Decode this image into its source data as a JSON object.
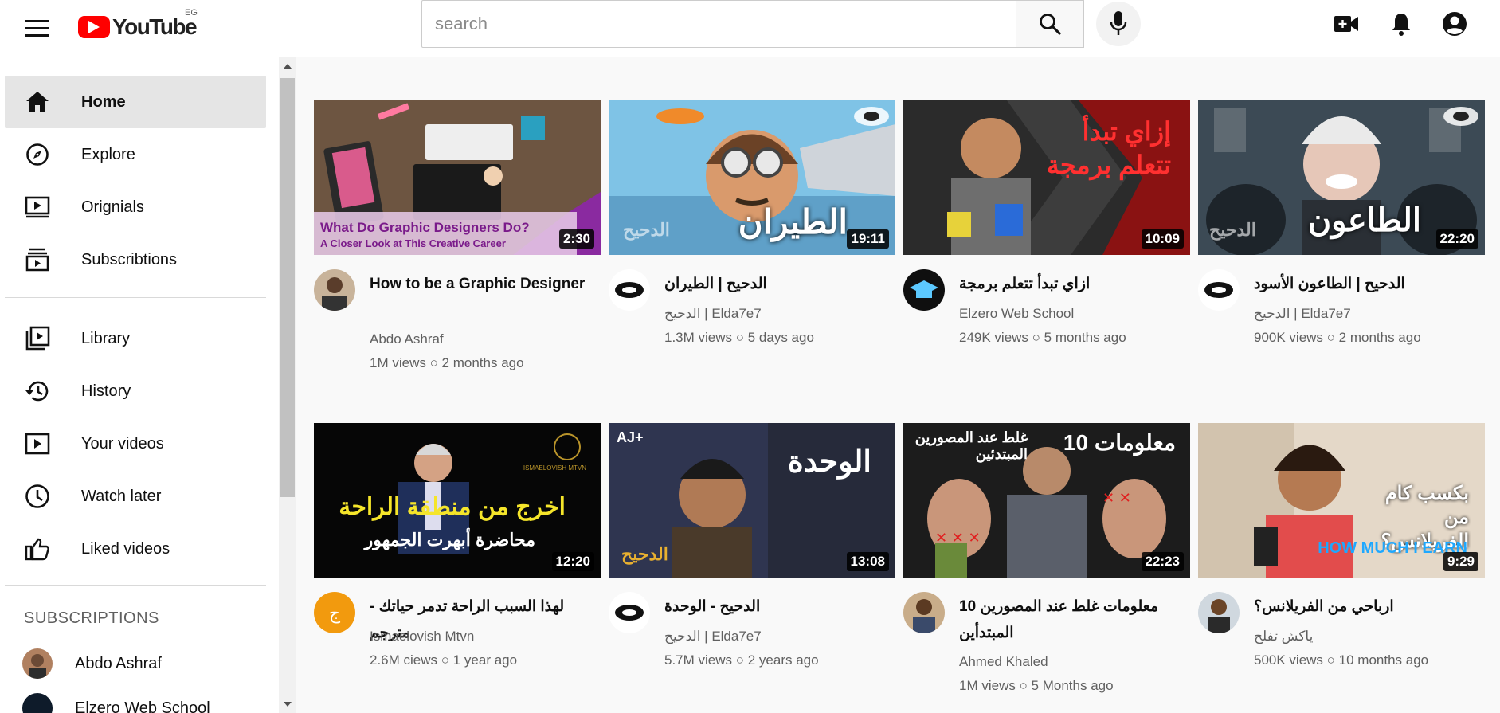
{
  "header": {
    "logo_text": "YouTube",
    "country_code": "EG",
    "search_placeholder": "search",
    "icons": [
      "hamburger-menu-icon",
      "search-icon",
      "microphone-icon",
      "video-camera-add-icon",
      "bell-icon",
      "account-circle-icon"
    ]
  },
  "sidebar": {
    "items": [
      {
        "label": "Home",
        "icon": "home-icon",
        "active": true
      },
      {
        "label": "Explore",
        "icon": "compass-icon"
      },
      {
        "label": "Orignials",
        "icon": "originals-icon"
      },
      {
        "label": "Subscribtions",
        "icon": "subscriptions-icon"
      },
      {
        "label": "Library",
        "icon": "library-icon"
      },
      {
        "label": "History",
        "icon": "history-icon"
      },
      {
        "label": "Your videos",
        "icon": "your-videos-icon"
      },
      {
        "label": "Watch later",
        "icon": "clock-icon"
      },
      {
        "label": "Liked videos",
        "icon": "thumbs-up-icon"
      }
    ],
    "subscriptions_heading": "SUBSCRIPTIONS",
    "subscriptions": [
      {
        "label": "Abdo Ashraf"
      },
      {
        "label": "Elzero Web School"
      }
    ]
  },
  "videos": [
    {
      "title": "How to be a Graphic Designer",
      "channel": "Abdo Ashraf",
      "stats": "1M views ○ 2 months ago",
      "duration": "2:30",
      "thumb_text": "What Do Graphic Designers Do?",
      "thumb_subtext": "A Closer Look at This Creative Career"
    },
    {
      "title": "الدحيح | الطيران",
      "channel": "الدحيح | Elda7e7",
      "stats": "1.3M views ○ 5 days ago",
      "duration": "19:11",
      "thumb_text": "الطيران",
      "thumb_subtext": "الدحيح"
    },
    {
      "title": "ازاي تبدأ تتعلم برمجة",
      "channel": "Elzero Web School",
      "stats": "249K views ○ 5 months ago",
      "duration": "10:09",
      "thumb_text": "إزاي تبدأ",
      "thumb_subtext": "تتعلم برمجة"
    },
    {
      "title": "الدحيح | الطاعون الأسود",
      "channel": "الدحيح | Elda7e7",
      "stats": "900K views ○ 2 months ago",
      "duration": "22:20",
      "thumb_text": "الطاعون",
      "thumb_subtext": "الدحيح"
    },
    {
      "title": "لهذا السبب الراحة تدمر حياتك - مترجم",
      "channel": "Ismaelovish Mtvn",
      "stats": "2.6M ciews ○ 1 year ago",
      "duration": "12:20",
      "thumb_text": "اخرج من منطقة الراحة",
      "thumb_subtext": "محاضرة أبهرت الجمهور",
      "thumb_badge": "ISMAELOVISH MTVN"
    },
    {
      "title": "الدحيح - الوحدة",
      "channel": "الدحيح | Elda7e7",
      "stats": "5.7M views ○ 2 years ago",
      "duration": "13:08",
      "thumb_text": "الوحدة",
      "thumb_subtext": "الدحيح",
      "thumb_badge": "AJ+"
    },
    {
      "title": "10 معلومات غلط عند المصورين المبتدأين",
      "channel": "Ahmed Khaled",
      "stats": "1M views ○ 5 Months ago",
      "duration": "22:23",
      "thumb_text": "10 معلومات",
      "thumb_subtext": "غلط عند المصورين المبتدئين"
    },
    {
      "title": "ارباحي من الفريلانس؟",
      "channel": "ياكش تفلح",
      "stats": "500K views ○ 10 months ago",
      "duration": "9:29",
      "thumb_text": "بكسب كام من الفريلانس؟",
      "thumb_subtext": "HOW MUCH I EARN"
    }
  ],
  "colors": {
    "brand_red": "#ff0000",
    "active_bg": "#e5e5e5",
    "main_bg": "#f9f9f9",
    "meta_text": "#606060"
  }
}
